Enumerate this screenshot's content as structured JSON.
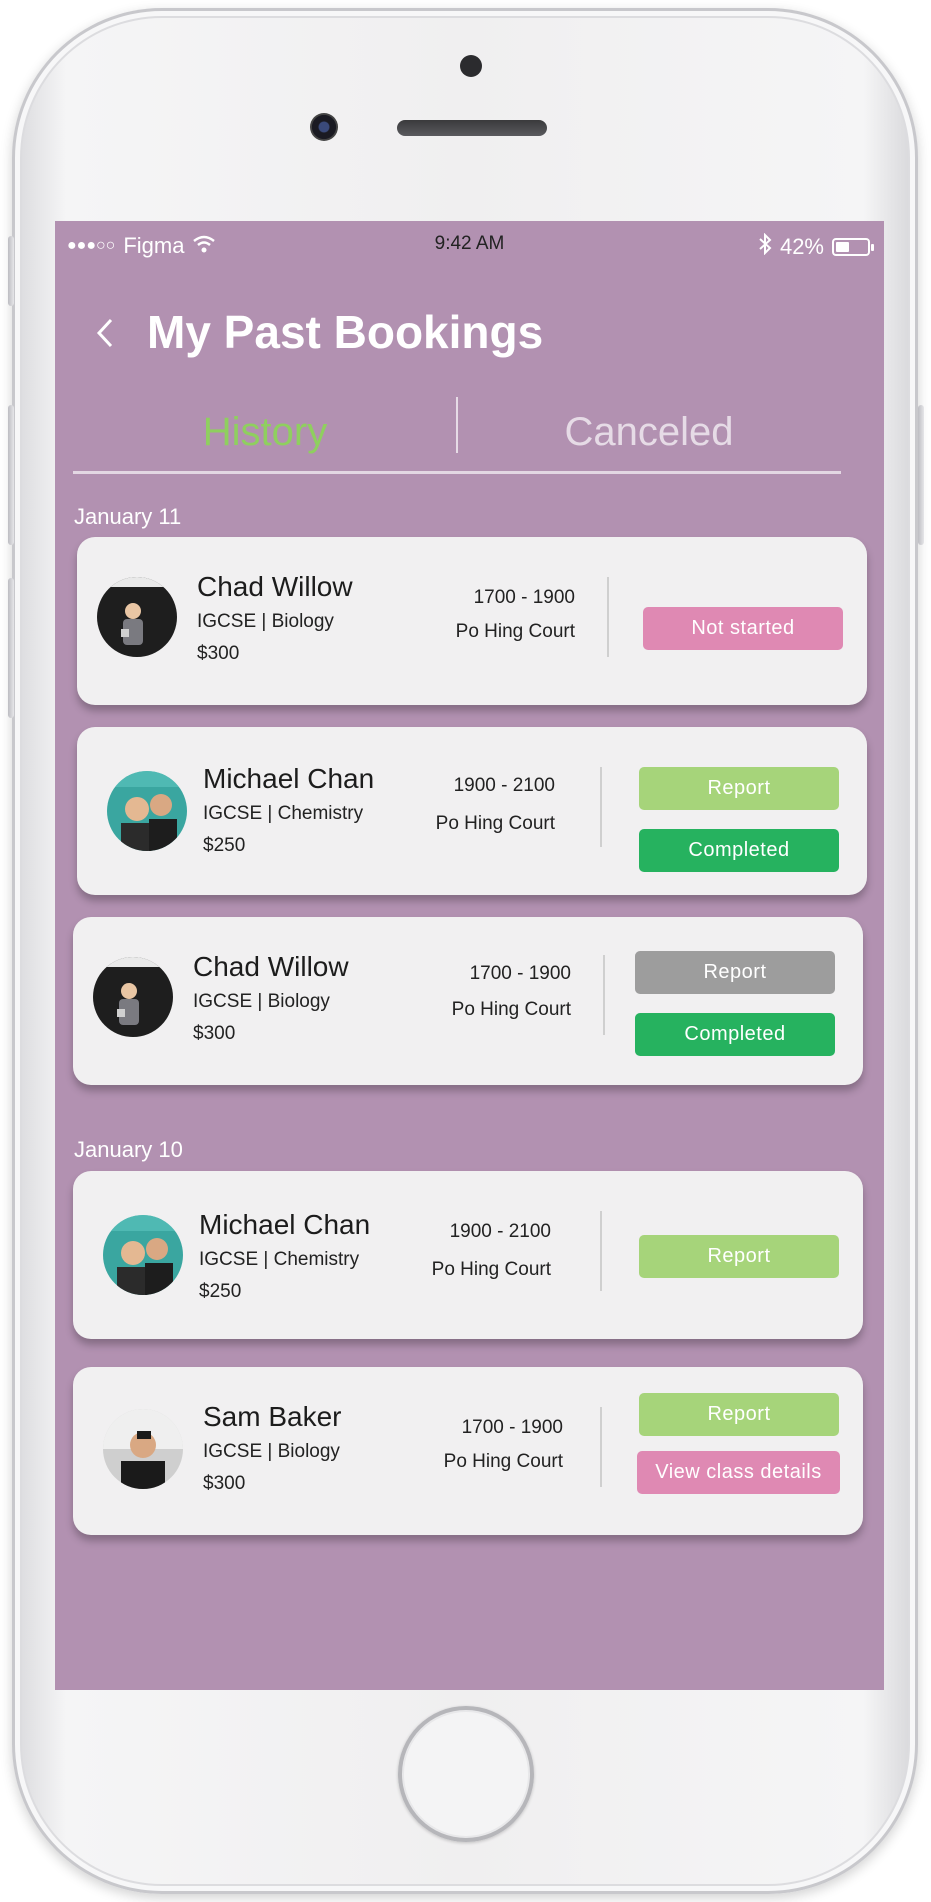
{
  "status_bar": {
    "carrier": "Figma",
    "time": "9:42 AM",
    "battery": "42%",
    "battery_level": 0.42
  },
  "header": {
    "title": "My Past Bookings"
  },
  "tabs": [
    {
      "label": "History"
    },
    {
      "label": "Canceled"
    }
  ],
  "sections": [
    {
      "date": "January 11"
    },
    {
      "date": "January 10"
    }
  ],
  "bookings": [
    {
      "name": "Chad Willow",
      "course": "IGCSE | Biology",
      "price": "$300",
      "time": "1700 - 1900",
      "location": "Po Hing Court",
      "buttons": [
        "Not started"
      ]
    },
    {
      "name": "Michael Chan",
      "course": "IGCSE | Chemistry",
      "price": "$250",
      "time": "1900 - 2100",
      "location": "Po Hing Court",
      "buttons": [
        "Report",
        "Completed"
      ]
    },
    {
      "name": "Chad Willow",
      "course": "IGCSE | Biology",
      "price": "$300",
      "time": "1700 - 1900",
      "location": "Po Hing Court",
      "buttons": [
        "Report",
        "Completed"
      ]
    },
    {
      "name": "Michael Chan",
      "course": "IGCSE | Chemistry",
      "price": "$250",
      "time": "1900 - 2100",
      "location": "Po Hing Court",
      "buttons": [
        "Report"
      ]
    },
    {
      "name": "Sam Baker",
      "course": "IGCSE | Biology",
      "price": "$300",
      "time": "1700 - 1900",
      "location": "Po Hing Court",
      "buttons": [
        "Report",
        "View class details"
      ]
    }
  ],
  "colors": {
    "screen_bg": "#b291b1",
    "tab_active": "#8fcf5f",
    "pink": "#df89b3",
    "light_green": "#a6d47a",
    "dark_green": "#26b25f",
    "gray": "#9d9d9d"
  }
}
